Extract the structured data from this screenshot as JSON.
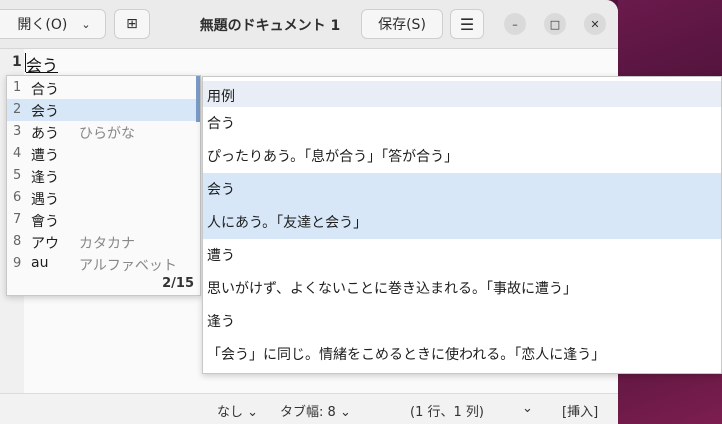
{
  "header": {
    "open_label": "開く(O)",
    "open_chevron": "⌄",
    "newtab_icon": "⊞",
    "title": "無題のドキュメント 1",
    "save_label": "保存(S)",
    "menu_icon": "☰",
    "min_icon": "–",
    "max_icon": "□",
    "close_icon": "✕"
  },
  "editor": {
    "line_number": "1",
    "line_text": "会う"
  },
  "candidates": {
    "items": [
      {
        "num": "1",
        "word": "合う",
        "note": ""
      },
      {
        "num": "2",
        "word": "会う",
        "note": ""
      },
      {
        "num": "3",
        "word": "あう",
        "note": "ひらがな"
      },
      {
        "num": "4",
        "word": "遭う",
        "note": ""
      },
      {
        "num": "5",
        "word": "逢う",
        "note": ""
      },
      {
        "num": "6",
        "word": "遇う",
        "note": ""
      },
      {
        "num": "7",
        "word": "會う",
        "note": ""
      },
      {
        "num": "8",
        "word": "アウ",
        "note": "カタカナ"
      },
      {
        "num": "9",
        "word": "au",
        "note": "アルファベット"
      }
    ],
    "selected_index": 1,
    "count": "2/15"
  },
  "examples": {
    "header": "用例",
    "entries": [
      {
        "word": "合う",
        "def": "ぴったりあう。「息が合う」「答が合う」"
      },
      {
        "word": "会う",
        "def": "人にあう。「友達と会う」"
      },
      {
        "word": "遭う",
        "def": "思いがけず、よくないことに巻き込まれる。「事故に遭う」"
      },
      {
        "word": "逢う",
        "def": "「会う」に同じ。情緒をこめるときに使われる。「恋人に逢う」"
      }
    ],
    "selected_index": 1
  },
  "status": {
    "lang": "なし",
    "tab_width": "タブ幅: 8",
    "position": "(1 行、1 列)",
    "mode": "[挿入]",
    "chevron": "⌄"
  },
  "colors": {
    "selection": "#d7e7f8",
    "accent": "#7a9cc6"
  }
}
